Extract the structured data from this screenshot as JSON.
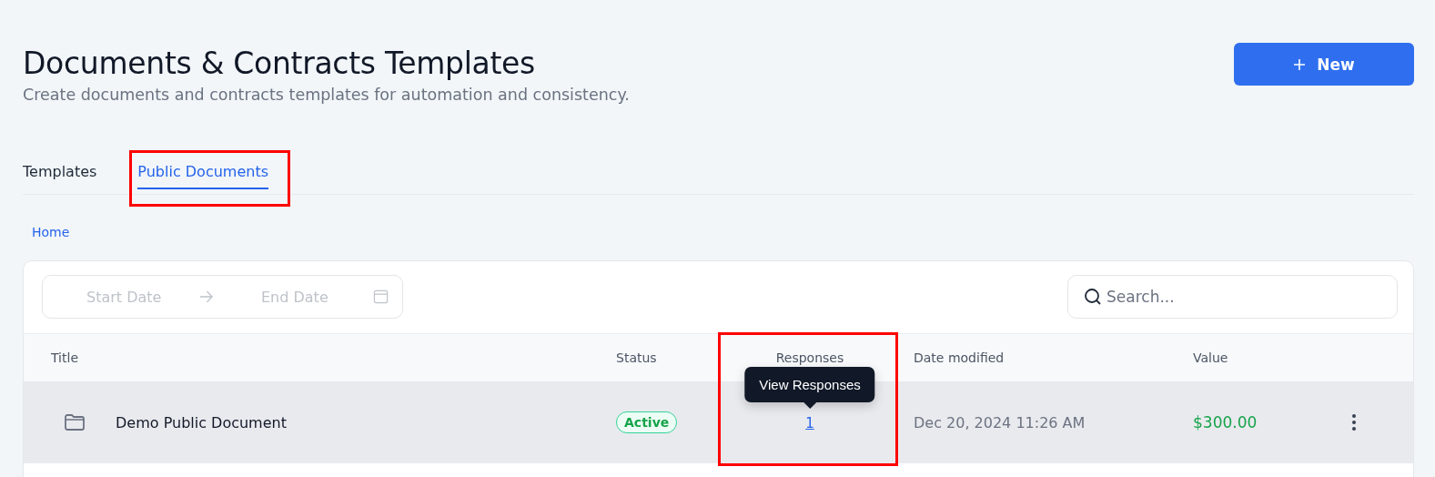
{
  "header": {
    "title": "Documents & Contracts Templates",
    "subtitle": "Create documents and contracts templates for automation and consistency.",
    "new_button": "New"
  },
  "tabs": [
    {
      "label": "Templates",
      "selected": false
    },
    {
      "label": "Public Documents",
      "selected": true
    }
  ],
  "breadcrumb": [
    "Home"
  ],
  "filters": {
    "start_placeholder": "Start Date",
    "end_placeholder": "End Date",
    "search_placeholder": "Search..."
  },
  "table": {
    "columns": [
      {
        "label": "Title"
      },
      {
        "label": "Status"
      },
      {
        "label": "Responses"
      },
      {
        "label": "Date modified"
      },
      {
        "label": "Value"
      }
    ],
    "rows": [
      {
        "title": "Demo Public Document",
        "status": "Active",
        "responses": "1",
        "tooltip": "View Responses",
        "date": "Dec 20, 2024 11:26 AM",
        "value": "$300.00",
        "hovered": true
      }
    ]
  }
}
